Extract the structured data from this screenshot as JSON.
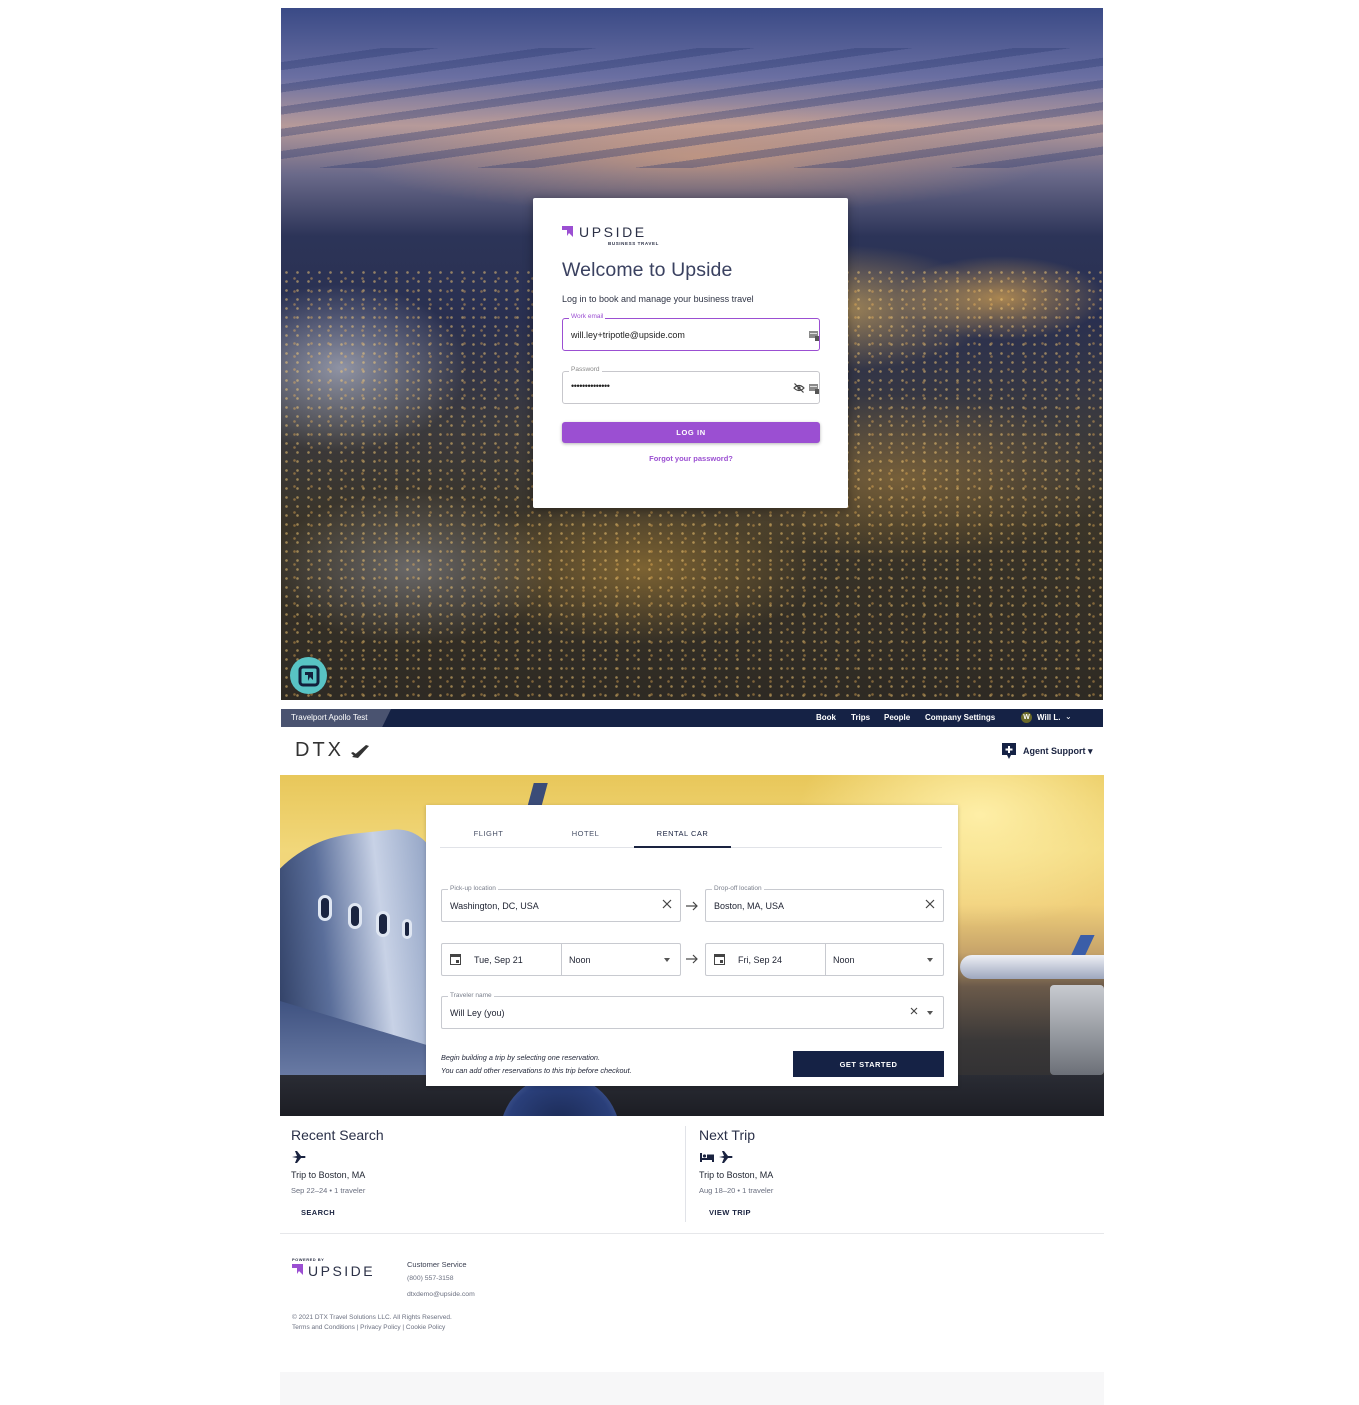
{
  "login": {
    "brand_name": "UPSIDE",
    "brand_sub": "BUSINESS TRAVEL",
    "title": "Welcome to Upside",
    "subtitle": "Log in to book and manage your business travel",
    "email_label": "Work email",
    "email_value": "will.ley+tripotle@upside.com",
    "password_label": "Password",
    "password_value": "••••••••••••••",
    "login_button": "LOG IN",
    "forgot_link": "Forgot your password?",
    "colors": {
      "accent": "#9b4fd2",
      "chat": "#58c3c4"
    }
  },
  "topnav": {
    "env": "Travelport Apollo Test",
    "links": [
      "Book",
      "Trips",
      "People",
      "Company Settings"
    ],
    "user_initial": "W",
    "user_name": "Will L.",
    "user_caret": "⌄"
  },
  "header": {
    "logo": "DTX",
    "agent_support": "Agent Support ▾"
  },
  "search": {
    "tabs": [
      "FLIGHT",
      "HOTEL",
      "RENTAL CAR"
    ],
    "active_tab": "RENTAL CAR",
    "pickup_label": "Pick-up location",
    "pickup_value": "Washington, DC, USA",
    "dropoff_label": "Drop-off location",
    "dropoff_value": "Boston, MA, USA",
    "pickup_date": "Tue, Sep 21",
    "pickup_time": "Noon",
    "dropoff_date": "Fri, Sep 24",
    "dropoff_time": "Noon",
    "traveler_label": "Traveler name",
    "traveler_value": "Will Ley (you)",
    "hint_line1": "Begin building a trip by selecting one reservation.",
    "hint_line2": "You can add other reservations to this trip before checkout.",
    "start_button": "GET STARTED"
  },
  "recent": {
    "title": "Recent Search",
    "trip": "Trip to Boston, MA",
    "meta": "Sep 22–24 • 1 traveler",
    "button": "SEARCH",
    "icons": [
      "airplane-icon"
    ]
  },
  "next": {
    "title": "Next Trip",
    "trip": "Trip to Boston, MA",
    "meta": "Aug 18–20 • 1 traveler",
    "button": "VIEW TRIP",
    "icons": [
      "hotel-bed-icon",
      "airplane-icon"
    ]
  },
  "footer": {
    "powered_by": "POWERED BY",
    "brand": "UPSIDE",
    "cs_title": "Customer Service",
    "cs_phone": "(800) 557-3158",
    "cs_email": "dtxdemo@upside.com",
    "copyright": "© 2021 DTX Travel Solutions LLC. All Rights Reserved.",
    "links": "Terms and Conditions | Privacy Policy | Cookie Policy"
  },
  "colors": {
    "navy": "#152245",
    "brand_purple": "#9b4fd2"
  }
}
